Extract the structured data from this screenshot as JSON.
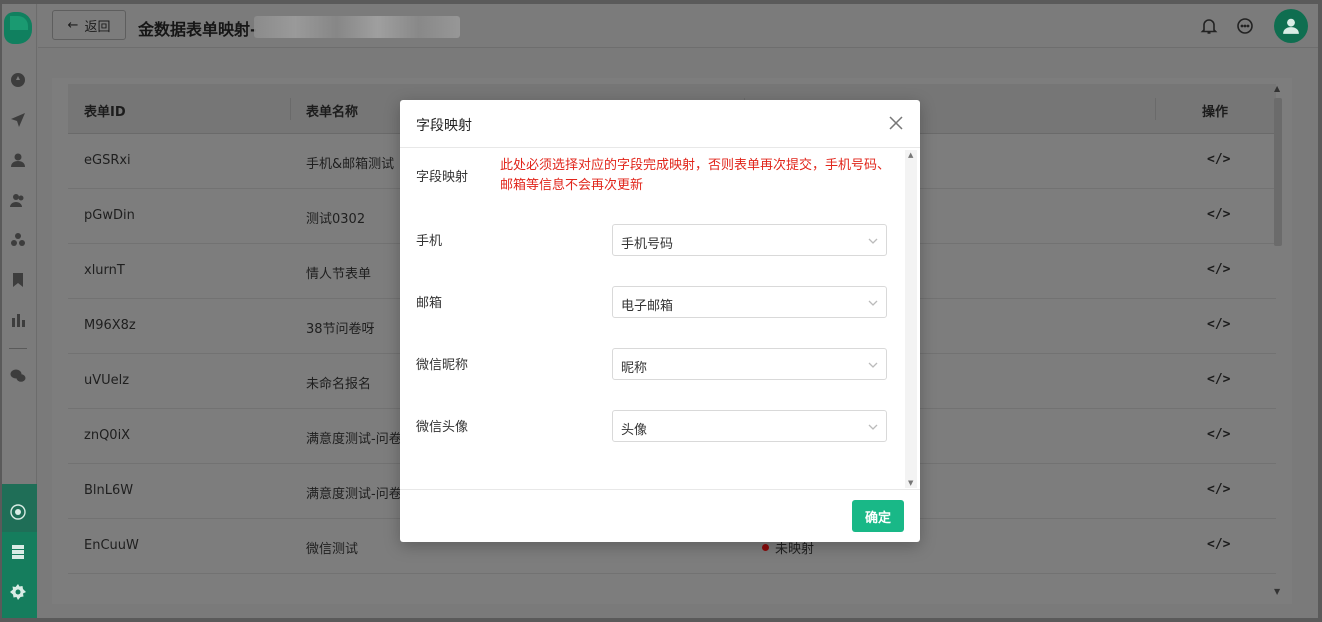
{
  "topbar": {
    "back_label": "返回",
    "title": "金数据表单映射-"
  },
  "table": {
    "headers": [
      "表单ID",
      "表单名称",
      "操作"
    ],
    "rows": [
      {
        "id": "eGSRxi",
        "name": "手机&邮箱测试",
        "status": ""
      },
      {
        "id": "pGwDin",
        "name": "测试0302",
        "status": ""
      },
      {
        "id": "xlurnT",
        "name": "情人节表单",
        "status": ""
      },
      {
        "id": "M96X8z",
        "name": "38节问卷呀",
        "status": ""
      },
      {
        "id": "uVUelz",
        "name": "未命名报名",
        "status": ""
      },
      {
        "id": "znQ0iX",
        "name": "满意度测试-问卷",
        "status": ""
      },
      {
        "id": "BlnL6W",
        "name": "满意度测试-问卷",
        "status": ""
      },
      {
        "id": "EnCuuW",
        "name": "微信测试",
        "status": "未映射"
      }
    ],
    "action_icon": "</>"
  },
  "modal": {
    "title": "字段映射",
    "notice_label": "字段映射",
    "notice": "此处必须选择对应的字段完成映射，否则表单再次提交，手机号码、邮箱等信息不会再次更新",
    "fields": [
      {
        "label": "手机",
        "value": "手机号码"
      },
      {
        "label": "邮箱",
        "value": "电子邮箱"
      },
      {
        "label": "微信昵称",
        "value": "昵称"
      },
      {
        "label": "微信头像",
        "value": "头像"
      }
    ],
    "ok_label": "确定"
  },
  "colors": {
    "brand": "#19b887",
    "warning": "#e1251b",
    "status_dot": "#8a0c0c"
  }
}
